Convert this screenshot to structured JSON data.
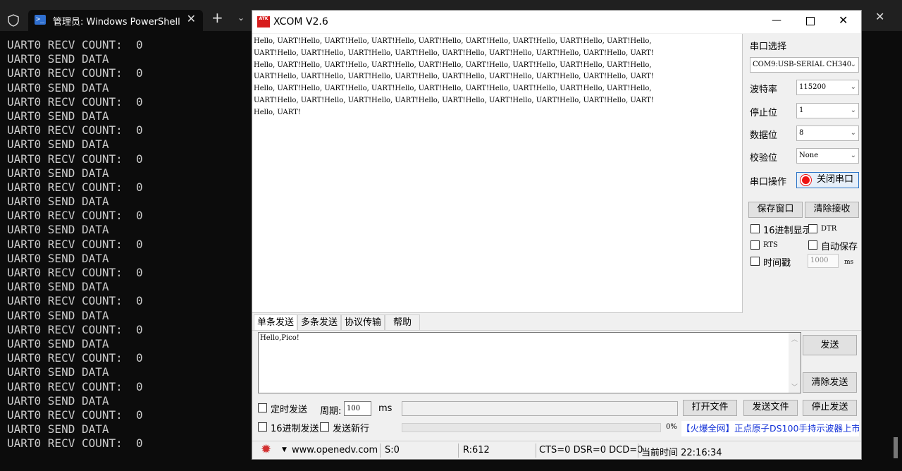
{
  "terminal": {
    "tab_title": "管理员: Windows PowerShell",
    "tab_icon_glyph": ">_",
    "new_tab": "+",
    "dropdown": "⌄",
    "close": "✕",
    "lines": [
      "UART0 RECV COUNT:  0",
      "UART0 SEND DATA",
      "UART0 RECV COUNT:  0",
      "UART0 SEND DATA",
      "UART0 RECV COUNT:  0",
      "UART0 SEND DATA",
      "UART0 RECV COUNT:  0",
      "UART0 SEND DATA",
      "UART0 RECV COUNT:  0",
      "UART0 SEND DATA",
      "UART0 RECV COUNT:  0",
      "UART0 SEND DATA",
      "UART0 RECV COUNT:  0",
      "UART0 SEND DATA",
      "UART0 RECV COUNT:  0",
      "UART0 SEND DATA",
      "UART0 RECV COUNT:  0",
      "UART0 SEND DATA",
      "UART0 RECV COUNT:  0",
      "UART0 SEND DATA",
      "UART0 RECV COUNT:  0",
      "UART0 SEND DATA",
      "UART0 RECV COUNT:  0",
      "UART0 SEND DATA",
      "UART0 RECV COUNT:  0",
      "UART0 SEND DATA",
      "UART0 RECV COUNT:  0",
      "UART0 SEND DATA",
      "UART0 RECV COUNT:  0"
    ]
  },
  "xcom": {
    "title": "XCOM V2.6",
    "logo_text": "ATK",
    "min": "—",
    "close": "✕",
    "receive_lines": [
      "Hello, UART!Hello, UART!Hello, UART!Hello, UART!Hello, UART!Hello, UART!Hello, UART!Hello, UART!Hello,",
      "UART!Hello, UART!Hello, UART!Hello, UART!Hello, UART!Hello, UART!Hello, UART!Hello, UART!Hello, UART!",
      "Hello, UART!Hello, UART!Hello, UART!Hello, UART!Hello, UART!Hello, UART!Hello, UART!Hello, UART!Hello,",
      "UART!Hello, UART!Hello, UART!Hello, UART!Hello, UART!Hello, UART!Hello, UART!Hello, UART!Hello, UART!",
      "Hello, UART!Hello, UART!Hello, UART!Hello, UART!Hello, UART!Hello, UART!Hello, UART!Hello, UART!Hello,",
      "UART!Hello, UART!Hello, UART!Hello, UART!Hello, UART!Hello, UART!Hello, UART!Hello, UART!Hello, UART!",
      "Hello, UART!"
    ],
    "config": {
      "port_label": "串口选择",
      "port_value": "COM9:USB-SERIAL CH340",
      "baud_label": "波特率",
      "baud_value": "115200",
      "stop_label": "停止位",
      "stop_value": "1",
      "data_label": "数据位",
      "data_value": "8",
      "parity_label": "校验位",
      "parity_value": "None",
      "op_label": "串口操作",
      "close_port_button": "关闭串口",
      "save_window_button": "保存窗口",
      "clear_receive_button": "清除接收",
      "hex_display": "16进制显示",
      "dtr": "DTR",
      "rts": "RTS",
      "auto_save": "自动保存",
      "timestamp": "时间戳",
      "timestamp_interval": "1000",
      "timestamp_unit": "ms"
    },
    "tabs": [
      "单条发送",
      "多条发送",
      "协议传输",
      "帮助"
    ],
    "send_text": "Hello,Pico!",
    "send_button": "发送",
    "clear_send_button": "清除发送",
    "options": {
      "timed_send": "定时发送",
      "period_label": "周期:",
      "period_value": "100",
      "period_unit": "ms",
      "open_file_button": "打开文件",
      "send_file_button": "发送文件",
      "stop_send_button": "停止发送",
      "hex_send": "16进制发送",
      "send_newline": "发送新行",
      "progress_percent": 0,
      "progress_text": "0%",
      "ad_text": "【火爆全网】正点原子DS100手持示波器上市"
    },
    "status": {
      "website": "www.openedv.com",
      "sent": "S:0",
      "received": "R:612",
      "lines": "CTS=0 DSR=0 DCD=0",
      "time": "当前时间 22:16:34"
    }
  },
  "colors": {
    "terminal_bg": "#0c0c0c",
    "terminal_text": "#cccccc",
    "xcom_panel": "#f0f0f0",
    "led_red": "#ee1111",
    "ad_blue": "#1433d8",
    "progress_green": "#06b025"
  }
}
